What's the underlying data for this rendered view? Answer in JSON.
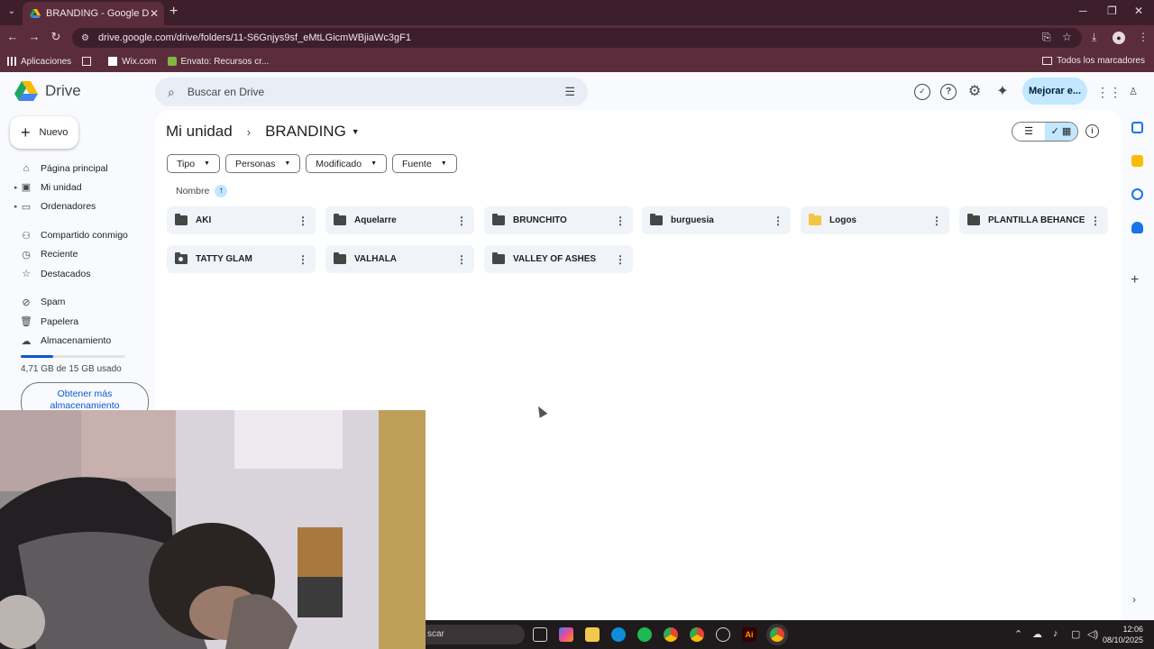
{
  "browser": {
    "tab_title": "BRANDING - Google Drive",
    "url": "drive.google.com/drive/folders/11-S6Gnjys9sf_eMtLGicmWBjiaWc3gF1",
    "bookmarks": [
      "Aplicaciones",
      "Wix.com",
      "Envato: Recursos cr..."
    ],
    "all_bookmarks": "Todos los marcadores"
  },
  "drive": {
    "logo": "Drive",
    "search_placeholder": "Buscar en Drive",
    "upgrade": "Mejorar e...",
    "new_button": "Nuevo",
    "nav": [
      {
        "label": "Página principal",
        "icon": "home-icon"
      },
      {
        "label": "Mi unidad",
        "icon": "my-drive-icon"
      },
      {
        "label": "Ordenadores",
        "icon": "computer-icon"
      },
      {
        "label": "Compartido conmigo",
        "icon": "people-icon"
      },
      {
        "label": "Reciente",
        "icon": "clock-icon"
      },
      {
        "label": "Destacados",
        "icon": "star-icon"
      },
      {
        "label": "Spam",
        "icon": "spam-icon"
      },
      {
        "label": "Papelera",
        "icon": "trash-icon"
      },
      {
        "label": "Almacenamiento",
        "icon": "cloud-icon"
      }
    ],
    "storage": {
      "used_text": "4,71 GB de 15 GB usado",
      "fraction": 0.314
    },
    "more_storage": "Obtener más almacenamiento",
    "breadcrumb": {
      "root": "Mi unidad",
      "current": "BRANDING"
    },
    "filters": [
      "Tipo",
      "Personas",
      "Modificado",
      "Fuente"
    ],
    "sort_label": "Nombre",
    "folders": [
      {
        "name": "AKI",
        "type": "folder"
      },
      {
        "name": "Aquelarre",
        "type": "folder"
      },
      {
        "name": "BRUNCHITO",
        "type": "folder"
      },
      {
        "name": "burguesia",
        "type": "folder"
      },
      {
        "name": "Logos",
        "type": "folder-yellow"
      },
      {
        "name": "PLANTILLA BEHANCE",
        "type": "folder"
      },
      {
        "name": "TATTY GLAM",
        "type": "folder-shared"
      },
      {
        "name": "VALHALA",
        "type": "folder"
      },
      {
        "name": "VALLEY OF ASHES",
        "type": "folder"
      }
    ]
  },
  "taskbar": {
    "search_text": "scar",
    "time": "12:06",
    "date": "08/10/2025"
  },
  "colors": {
    "browser_frame": "#3c1f2b",
    "browser_toolbar": "#5a2c3c",
    "drive_accent": "#0b57d0",
    "upgrade_bg": "#c2e7ff",
    "folder_card": "#f0f4f9"
  }
}
